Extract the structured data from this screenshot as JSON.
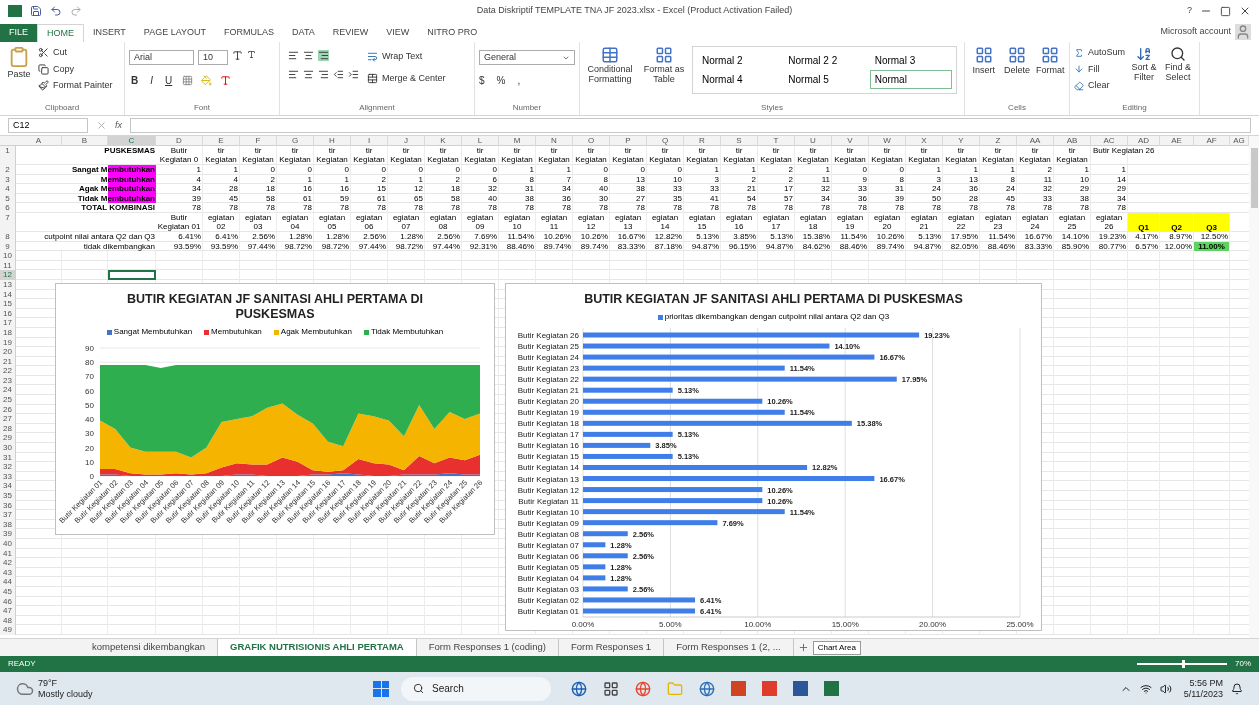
{
  "window": {
    "title": "Data Diskriptif TEMPLATE TNA JF 2023.xlsx - Excel (Product Activation Failed)",
    "help": "?",
    "account": "Microsoft account"
  },
  "tabs": [
    {
      "label": "FILE",
      "kind": "file",
      "selected": false
    },
    {
      "label": "HOME",
      "kind": "tab",
      "selected": true
    },
    {
      "label": "INSERT",
      "kind": "tab",
      "selected": false
    },
    {
      "label": "PAGE LAYOUT",
      "kind": "tab",
      "selected": false
    },
    {
      "label": "FORMULAS",
      "kind": "tab",
      "selected": false
    },
    {
      "label": "DATA",
      "kind": "tab",
      "selected": false
    },
    {
      "label": "REVIEW",
      "kind": "tab",
      "selected": false
    },
    {
      "label": "VIEW",
      "kind": "tab",
      "selected": false
    },
    {
      "label": "NITRO PRO",
      "kind": "tab",
      "selected": false
    }
  ],
  "ribbon": {
    "clipboard": {
      "label": "Clipboard",
      "paste": "Paste",
      "items": [
        "Cut",
        "Copy",
        "Format Painter"
      ]
    },
    "font": {
      "label": "Font",
      "family": "Arial",
      "size": "10",
      "buttons": [
        "B",
        "I",
        "U"
      ]
    },
    "alignment": {
      "label": "Alignment",
      "wrap": "Wrap Text",
      "merge": "Merge & Center"
    },
    "number": {
      "label": "Number",
      "format": "General",
      "buttons": [
        "$",
        "%",
        ","
      ]
    },
    "styles": {
      "label": "Styles",
      "conditional": "Conditional Formatting",
      "format_table": "Format as Table",
      "cell_styles": [
        {
          "label": "Normal 2",
          "selected": false
        },
        {
          "label": "Normal 2 2",
          "selected": false
        },
        {
          "label": "Normal 3",
          "selected": false
        },
        {
          "label": "Normal 4",
          "selected": false
        },
        {
          "label": "Normal 5",
          "selected": false
        },
        {
          "label": "Normal",
          "selected": true
        }
      ]
    },
    "cells": {
      "label": "Cells",
      "buttons": [
        "Insert",
        "Delete",
        "Format"
      ]
    },
    "editing": {
      "label": "Editing",
      "items": [
        "AutoSum",
        "Fill",
        "Clear"
      ],
      "buttons": [
        "Sort & Filter",
        "Find & Select"
      ]
    }
  },
  "formula_bar": {
    "name_box": "C12",
    "fx": "fx"
  },
  "columns": [
    {
      "label": "A",
      "selected": false
    },
    {
      "label": "B",
      "selected": false
    },
    {
      "label": "C",
      "selected": true
    },
    {
      "label": "D",
      "selected": false
    },
    {
      "label": "E",
      "selected": false
    },
    {
      "label": "F",
      "selected": false
    },
    {
      "label": "G",
      "selected": false
    },
    {
      "label": "H",
      "selected": false
    },
    {
      "label": "I",
      "selected": false
    },
    {
      "label": "J",
      "selected": false
    },
    {
      "label": "K",
      "selected": false
    },
    {
      "label": "L",
      "selected": false
    },
    {
      "label": "M",
      "selected": false
    },
    {
      "label": "N",
      "selected": false
    },
    {
      "label": "O",
      "selected": false
    },
    {
      "label": "P",
      "selected": false
    },
    {
      "label": "Q",
      "selected": false
    },
    {
      "label": "R",
      "selected": false
    },
    {
      "label": "S",
      "selected": false
    },
    {
      "label": "T",
      "selected": false
    },
    {
      "label": "U",
      "selected": false
    },
    {
      "label": "V",
      "selected": false
    },
    {
      "label": "W",
      "selected": false
    },
    {
      "label": "X",
      "selected": false
    },
    {
      "label": "Y",
      "selected": false
    },
    {
      "label": "Z",
      "selected": false
    },
    {
      "label": "AA",
      "selected": false
    },
    {
      "label": "AB",
      "selected": false
    },
    {
      "label": "AC",
      "selected": false
    },
    {
      "label": "AD",
      "selected": false
    },
    {
      "label": "AE",
      "selected": false
    },
    {
      "label": "AF",
      "selected": false
    },
    {
      "label": "AG",
      "selected": false
    }
  ],
  "rows": [
    {
      "label": "PUSKESMAS",
      "kind": "plain",
      "cells": [
        "Butir Kegiatan 0",
        "tir Kegiatan",
        "tir Kegiatan",
        "tir Kegiatan",
        "tir Kegiatan",
        "tir Kegiatan",
        "tir Kegiatan",
        "tir Kegiatan",
        "tir Kegiatan",
        "tir Kegiatan",
        "tir Kegiatan",
        "tir Kegiatan",
        "tir Kegiatan",
        "tir Kegiatan",
        "tir Kegiatan",
        "tir Kegiatan",
        "tir Kegiatan",
        "tir Kegiatan",
        "tir Kegiatan",
        "tir Kegiatan",
        "tir Kegiatan",
        "tir Kegiatan",
        "tir Kegiatan",
        "tir Kegiatan",
        "tir Kegiatan",
        "Butir Kegiatan 26"
      ],
      "extra": []
    },
    {
      "label": "Sangat Membutuhkan",
      "kind": "highlight",
      "cells": [
        "1",
        "1",
        "0",
        "0",
        "0",
        "0",
        "0",
        "0",
        "0",
        "1",
        "1",
        "0",
        "0",
        "0",
        "1",
        "1",
        "2",
        "1",
        "0",
        "0",
        "1",
        "1",
        "1",
        "2",
        "1",
        "1"
      ],
      "extra": []
    },
    {
      "label": "Membutuhkan",
      "kind": "highlight",
      "cells": [
        "4",
        "4",
        "2",
        "1",
        "1",
        "2",
        "1",
        "2",
        "6",
        "8",
        "7",
        "8",
        "13",
        "10",
        "3",
        "2",
        "2",
        "11",
        "9",
        "8",
        "3",
        "13",
        "8",
        "11",
        "10",
        "14"
      ],
      "extra": []
    },
    {
      "label": "Agak Membutuhkan",
      "kind": "highlight",
      "cells": [
        "34",
        "28",
        "18",
        "16",
        "16",
        "15",
        "12",
        "18",
        "32",
        "31",
        "34",
        "40",
        "38",
        "33",
        "33",
        "21",
        "17",
        "32",
        "33",
        "31",
        "24",
        "36",
        "24",
        "32",
        "29",
        "29"
      ],
      "extra": []
    },
    {
      "label": "Tidak Membutuhkan",
      "kind": "highlight",
      "cells": [
        "39",
        "45",
        "58",
        "61",
        "59",
        "61",
        "65",
        "58",
        "40",
        "38",
        "36",
        "30",
        "27",
        "35",
        "41",
        "54",
        "57",
        "34",
        "36",
        "39",
        "50",
        "28",
        "45",
        "33",
        "38",
        "34"
      ],
      "extra": []
    },
    {
      "label": "TOTAL KOMBINASI",
      "kind": "plain",
      "cells": [
        "78",
        "78",
        "78",
        "78",
        "78",
        "78",
        "78",
        "78",
        "78",
        "78",
        "78",
        "78",
        "78",
        "78",
        "78",
        "78",
        "78",
        "78",
        "78",
        "78",
        "78",
        "78",
        "78",
        "78",
        "78",
        "78"
      ],
      "extra": []
    },
    {
      "kind": "header",
      "cells": [
        "Butir Kegiatan 01",
        "egiatan 02",
        "egiatan 03",
        "egiatan 04",
        "egiatan 05",
        "egiatan 06",
        "egiatan 07",
        "egiatan 08",
        "egiatan 09",
        "egiatan 10",
        "egiatan 11",
        "egiatan 12",
        "egiatan 13",
        "egiatan 14",
        "egiatan 15",
        "egiatan 16",
        "egiatan 17",
        "egiatan 18",
        "egiatan 19",
        "egiatan 20",
        "egiatan 21",
        "egiatan 22",
        "egiatan 23",
        "egiatan 24",
        "egiatan 25",
        "egiatan 26"
      ],
      "extra": [
        {
          "text": "Q1",
          "color": "#ffff00"
        },
        {
          "text": "Q2",
          "color": "#ffff00"
        },
        {
          "text": "Q3",
          "color": "#ffff00"
        }
      ]
    },
    {
      "label": "cutpoint nilai antara Q2 dan Q3",
      "kind": "wide",
      "cells": [
        "6.41%",
        "6.41%",
        "2.56%",
        "1.28%",
        "1.28%",
        "2.56%",
        "1.28%",
        "2.56%",
        "7.69%",
        "11.54%",
        "10.26%",
        "10.26%",
        "16.67%",
        "12.82%",
        "5.13%",
        "3.85%",
        "5.13%",
        "15.38%",
        "11.54%",
        "10.26%",
        "5.13%",
        "17.95%",
        "11.54%",
        "16.67%",
        "14.10%",
        "19.23%"
      ],
      "extra": [
        {
          "text": "4.17%"
        },
        {
          "text": "8.97%"
        },
        {
          "text": "12.50%"
        }
      ]
    },
    {
      "label": "tidak dikembangkan",
      "kind": "wide",
      "cells": [
        "93.59%",
        "93.59%",
        "97.44%",
        "98.72%",
        "98.72%",
        "97.44%",
        "98.72%",
        "97.44%",
        "92.31%",
        "88.46%",
        "89.74%",
        "89.74%",
        "83.33%",
        "87.18%",
        "94.87%",
        "96.15%",
        "94.87%",
        "84.62%",
        "88.46%",
        "89.74%",
        "94.87%",
        "82.05%",
        "88.46%",
        "83.33%",
        "85.90%",
        "80.77%"
      ],
      "extra": [
        {
          "text": "6.57%"
        },
        {
          "text": "12.00%"
        },
        {
          "text": "11.00%",
          "color": "#5fd35f"
        }
      ]
    }
  ],
  "row_numbers": [
    {
      "label": "1",
      "selected": false
    },
    {
      "label": "2",
      "selected": false
    },
    {
      "label": "3",
      "selected": false
    },
    {
      "label": "4",
      "selected": false
    },
    {
      "label": "5",
      "selected": false
    },
    {
      "label": "6",
      "selected": false
    },
    {
      "label": "7",
      "selected": false
    },
    {
      "label": "8",
      "selected": false
    },
    {
      "label": "9",
      "selected": false
    },
    {
      "label": "10",
      "selected": false
    },
    {
      "label": "11",
      "selected": false
    },
    {
      "label": "12",
      "selected": true
    },
    {
      "label": "13",
      "selected": false
    },
    {
      "label": "14",
      "selected": false
    },
    {
      "label": "15",
      "selected": false
    },
    {
      "label": "16",
      "selected": false
    },
    {
      "label": "17",
      "selected": false
    },
    {
      "label": "18",
      "selected": false
    },
    {
      "label": "19",
      "selected": false
    },
    {
      "label": "20",
      "selected": false
    },
    {
      "label": "21",
      "selected": false
    },
    {
      "label": "22",
      "selected": false
    },
    {
      "label": "23",
      "selected": false
    },
    {
      "label": "24",
      "selected": false
    },
    {
      "label": "25",
      "selected": false
    },
    {
      "label": "26",
      "selected": false
    },
    {
      "label": "27",
      "selected": false
    },
    {
      "label": "28",
      "selected": false
    },
    {
      "label": "29",
      "selected": false
    },
    {
      "label": "30",
      "selected": false
    },
    {
      "label": "31",
      "selected": false
    },
    {
      "label": "32",
      "selected": false
    },
    {
      "label": "33",
      "selected": false
    },
    {
      "label": "34",
      "selected": false
    },
    {
      "label": "35",
      "selected": false
    },
    {
      "label": "36",
      "selected": false
    },
    {
      "label": "37",
      "selected": false
    },
    {
      "label": "38",
      "selected": false
    },
    {
      "label": "39",
      "selected": false
    },
    {
      "label": "40",
      "selected": false
    },
    {
      "label": "41",
      "selected": false
    },
    {
      "label": "42",
      "selected": false
    },
    {
      "label": "43",
      "selected": false
    },
    {
      "label": "44",
      "selected": false
    },
    {
      "label": "45",
      "selected": false
    },
    {
      "label": "46",
      "selected": false
    },
    {
      "label": "47",
      "selected": false
    },
    {
      "label": "48",
      "selected": false
    },
    {
      "label": "49",
      "selected": false
    }
  ],
  "area_chart": {
    "chart_data": {
      "type": "area",
      "stacked": true,
      "grid": true,
      "legend": true,
      "title": "BUTIR KEGIATAN JF SANITASI AHLI PERTAMA DI PUSKESMAS",
      "categories": [
        "Butir Kegiatan 01",
        "Butir Kegiatan 02",
        "Butir Kegiatan 03",
        "Butir Kegiatan 04",
        "Butir Kegiatan 05",
        "Butir Kegiatan 06",
        "Butir Kegiatan 07",
        "Butir Kegiatan 08",
        "Butir Kegiatan 09",
        "Butir Kegiatan 10",
        "Butir Kegiatan 11",
        "Butir Kegiatan 12",
        "Butir Kegiatan 13",
        "Butir Kegiatan 14",
        "Butir Kegiatan 15",
        "Butir Kegiatan 16",
        "Butir Kegiatan 17",
        "Butir Kegiatan 18",
        "Butir Kegiatan 19",
        "Butir Kegiatan 20",
        "Butir Kegiatan 21",
        "Butir Kegiatan 22",
        "Butir Kegiatan 23",
        "Butir Kegiatan 24",
        "Butir Kegiatan 25",
        "Butir Kegiatan 26"
      ],
      "series": [
        {
          "name": "Sangat Membutuhkan",
          "color": "#4472c4",
          "values": [
            1,
            1,
            0,
            0,
            0,
            0,
            0,
            0,
            0,
            1,
            1,
            0,
            0,
            0,
            1,
            1,
            2,
            1,
            0,
            0,
            1,
            1,
            1,
            2,
            1,
            1
          ]
        },
        {
          "name": "Membutuhkan",
          "color": "#e8312f",
          "values": [
            4,
            4,
            2,
            1,
            1,
            2,
            1,
            2,
            6,
            8,
            7,
            8,
            13,
            10,
            3,
            2,
            2,
            11,
            9,
            8,
            3,
            13,
            8,
            11,
            10,
            14
          ]
        },
        {
          "name": "Agak Membutuhkan",
          "color": "#f5b400",
          "values": [
            34,
            28,
            18,
            16,
            16,
            15,
            12,
            18,
            32,
            31,
            34,
            40,
            38,
            33,
            33,
            21,
            17,
            32,
            33,
            31,
            24,
            36,
            24,
            32,
            29,
            29
          ]
        },
        {
          "name": "Tidak Membutuhkan",
          "color": "#2eae4f",
          "values": [
            39,
            45,
            58,
            61,
            59,
            61,
            65,
            58,
            40,
            38,
            36,
            30,
            27,
            35,
            41,
            54,
            57,
            34,
            36,
            39,
            50,
            28,
            45,
            33,
            38,
            34
          ]
        }
      ],
      "ylim": [
        0,
        90
      ],
      "yticks": [
        0,
        10,
        20,
        30,
        40,
        50,
        60,
        70,
        80,
        90
      ]
    }
  },
  "bar_chart": {
    "chart_data": {
      "type": "bar",
      "orientation": "horizontal",
      "grid": true,
      "legend": true,
      "title": "BUTIR KEGIATAN JF SANITASI AHLI PERTAMA DI PUSKESMAS",
      "categories": [
        "Butir Kegiatan 26",
        "Butir Kegiatan 25",
        "Butir Kegiatan 24",
        "Butir Kegiatan 23",
        "Butir Kegiatan 22",
        "Butir Kegiatan 21",
        "Butir Kegiatan 20",
        "Butir Kegiatan 19",
        "Butir Kegiatan 18",
        "Butir Kegiatan 17",
        "Butir Kegiatan 16",
        "Butir Kegiatan 15",
        "Butir Kegiatan 14",
        "Butir Kegiatan 13",
        "Butir Kegiatan 12",
        "Butir Kegiatan 11",
        "Butir Kegiatan 10",
        "Butir Kegiatan 09",
        "Butir Kegiatan 08",
        "Butir Kegiatan 07",
        "Butir Kegiatan 06",
        "Butir Kegiatan 05",
        "Butir Kegiatan 04",
        "Butir Kegiatan 03",
        "Butir Kegiatan 02",
        "Butir Kegiatan 01"
      ],
      "series": [
        {
          "name": "prioritas dikembangkan dengan cutpoint nilai antara Q2 dan Q3",
          "color": "#3f7ee8",
          "values": [
            19.23,
            14.1,
            16.67,
            11.54,
            17.95,
            5.13,
            10.26,
            11.54,
            15.38,
            5.13,
            3.85,
            5.13,
            12.82,
            16.67,
            10.26,
            10.26,
            11.54,
            7.69,
            2.56,
            1.28,
            2.56,
            1.28,
            1.28,
            2.56,
            6.41,
            6.41
          ]
        }
      ],
      "value_labels": [
        "19.23%",
        "14.10%",
        "16.67%",
        "11.54%",
        "17.95%",
        "5.13%",
        "10.26%",
        "11.54%",
        "15.38%",
        "5.13%",
        "3.85%",
        "5.13%",
        "12.82%",
        "16.67%",
        "10.26%",
        "10.26%",
        "11.54%",
        "7.69%",
        "2.56%",
        "1.28%",
        "2.56%",
        "1.28%",
        "1.28%",
        "2.56%",
        "6.41%",
        "6.41%"
      ],
      "xlim": [
        0,
        25
      ],
      "xticks": [
        {
          "value": 0,
          "label": "0.00%"
        },
        {
          "value": 5,
          "label": "5.00%"
        },
        {
          "value": 10,
          "label": "10.00%"
        },
        {
          "value": 15,
          "label": "15.00%"
        },
        {
          "value": 20,
          "label": "20.00%"
        },
        {
          "value": 25,
          "label": "25.00%"
        }
      ]
    }
  },
  "sheet_tabs": [
    {
      "label": "kompetensi dikembangkan",
      "selected": false
    },
    {
      "label": "GRAFIK NUTRISIONIS AHLI PERTAMA",
      "selected": true
    },
    {
      "label": "Form Responses 1 (coding)",
      "selected": false
    },
    {
      "label": "Form Responses 1",
      "selected": false
    },
    {
      "label": "Form Responses 1 (2, ...",
      "selected": false
    }
  ],
  "tooltip": "Chart Area",
  "status_bar": {
    "status": "READY",
    "zoom": "70%",
    "zoom_slider": {
      "level": 0.5
    }
  },
  "taskbar": {
    "temperature": "79°F",
    "weather": "Mostly cloudy",
    "search": "Search",
    "time": "5:56 PM",
    "date": "5/11/2023"
  }
}
